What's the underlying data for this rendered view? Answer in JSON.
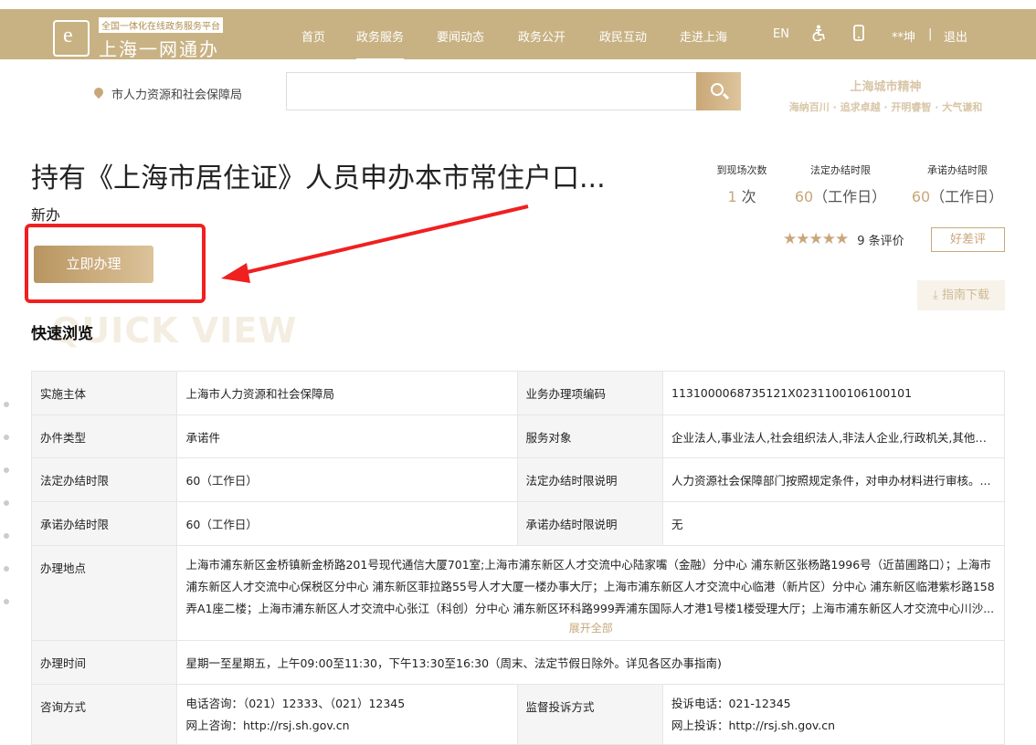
{
  "header": {
    "logo_sub": "全国一体化在线政务服务平台",
    "logo_main": "上海一网通办",
    "nav": [
      "首页",
      "政务服务",
      "要闻动态",
      "政务公开",
      "政民互动",
      "走进上海"
    ],
    "active_nav": "政务服务",
    "lang": "EN",
    "user": "**坤",
    "separator": "|",
    "logout": "退出"
  },
  "search": {
    "location": "市人力资源和社会保障局",
    "placeholder": ""
  },
  "spirit": {
    "title": "上海城市精神",
    "sub": "海纳百川 · 追求卓越 · 开明睿智 · 大气谦和"
  },
  "service": {
    "title": "持有《上海市居住证》人员申办本市常住户口...",
    "subtitle": "新办",
    "apply_label": "立即办理",
    "stats": [
      {
        "label": "到现场次数",
        "num": "1",
        "unit": "次"
      },
      {
        "label": "法定办结时限",
        "num": "60",
        "unit": "（工作日）"
      },
      {
        "label": "承诺办结时限",
        "num": "60",
        "unit": "（工作日）"
      }
    ],
    "stars": "★★★★★",
    "rating_count": "9 条评价",
    "review_btn": "好差评",
    "guide_btn": "指南下载"
  },
  "quick": {
    "title": "快速浏览",
    "bg_text": "QUICK VIEW"
  },
  "table": {
    "r1": {
      "k1": "实施主体",
      "v1": "上海市人力资源和社会保障局",
      "k2": "业务办理项编码",
      "v2": "1131000068735121X0231100106100101"
    },
    "r2": {
      "k1": "办件类型",
      "v1": "承诺件",
      "k2": "服务对象",
      "v2": "企业法人,事业法人,社会组织法人,非法人企业,行政机关,其他组织"
    },
    "r3": {
      "k1": "法定办结时限",
      "v1": "60（工作日）",
      "k2": "法定办结时限说明",
      "v2": "人力资源社会保障部门按照规定条件，对申办材料进行审核。..."
    },
    "r4": {
      "k1": "承诺办结时限",
      "v1": "60（工作日）",
      "k2": "承诺办结时限说明",
      "v2": "无"
    },
    "r5": {
      "k1": "办理地点",
      "v1": "上海市浦东新区金桥镇新金桥路201号现代通信大厦701室;上海市浦东新区人才交流中心陆家嘴（金融）分中心 浦东新区张杨路1996号（近苗圃路口）；上海市浦东新区人才交流中心保税区分中心 浦东新区菲拉路55号人才大厦一楼办事大厅；上海市浦东新区人才交流中心临港（新片区）分中心 浦东新区临港紫杉路158弄A1座二楼；上海市浦东新区人才交流中心张江（科创）分中心 浦东新区环科路999弄浦东国际人才港1号楼1楼受理大厅；上海市浦东新区人才交流中心川沙...",
      "expand": "展开全部"
    },
    "r6": {
      "k1": "办理时间",
      "v1": "星期一至星期五，上午09:00至11:30，下午13:30至16:30（周末、法定节假日除外。详见各区办事指南)"
    },
    "r7": {
      "k1": "咨询方式",
      "v1a": "电话咨询：（021）12333、（021）12345",
      "v1b": "网上咨询：http://rsj.sh.gov.cn",
      "k2": "监督投诉方式",
      "v2a": "投诉电话：021-12345",
      "v2b": "网上投诉：http://rsj.sh.gov.cn"
    }
  }
}
